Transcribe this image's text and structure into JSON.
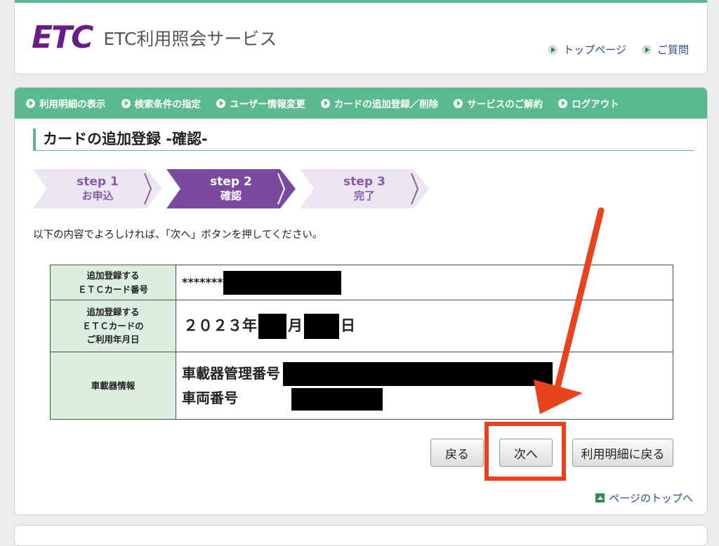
{
  "header": {
    "logo": "ETC",
    "title": "ETC利用照会サービス",
    "links": [
      {
        "label": "トップページ",
        "icon": "arrow-bullet-icon"
      },
      {
        "label": "ご質問",
        "icon": "arrow-bullet-icon"
      }
    ]
  },
  "nav": [
    {
      "label": "利用明細の表示"
    },
    {
      "label": "検索条件の指定"
    },
    {
      "label": "ユーザー情報変更"
    },
    {
      "label": "カードの追加登録／削除"
    },
    {
      "label": "サービスのご解約"
    },
    {
      "label": "ログアウト"
    }
  ],
  "page": {
    "title": "カードの追加登録 -確認-",
    "steps": [
      {
        "line1": "step 1",
        "line2": "お申込",
        "state": "inactive"
      },
      {
        "line1": "step 2",
        "line2": "確認",
        "state": "active"
      },
      {
        "line1": "step 3",
        "line2": "完了",
        "state": "inactive"
      }
    ],
    "instruction": "以下の内容でよろしければ、「次へ」ボタンを押してください。"
  },
  "table": {
    "card_number": {
      "label_lines": [
        "追加登録する",
        "ＥＴＣカード番号"
      ],
      "value_prefix": "*******"
    },
    "usage_date": {
      "label_lines": [
        "追加登録する",
        "ＥＴＣカードの",
        "ご利用年月日"
      ],
      "year": "２０２３年",
      "month_suffix": "月",
      "day_suffix": "日"
    },
    "device": {
      "label": "車載器情報",
      "mgmt_label": "車載器管理番号",
      "vehicle_label": "車両番号"
    }
  },
  "buttons": {
    "back": "戻る",
    "next": "次へ",
    "back_to_list": "利用明細に戻る"
  },
  "page_top": "ページのトップへ",
  "colors": {
    "brand_green": "#5bb990",
    "brand_purple": "#6a1d88",
    "highlight": "#e8431d"
  }
}
